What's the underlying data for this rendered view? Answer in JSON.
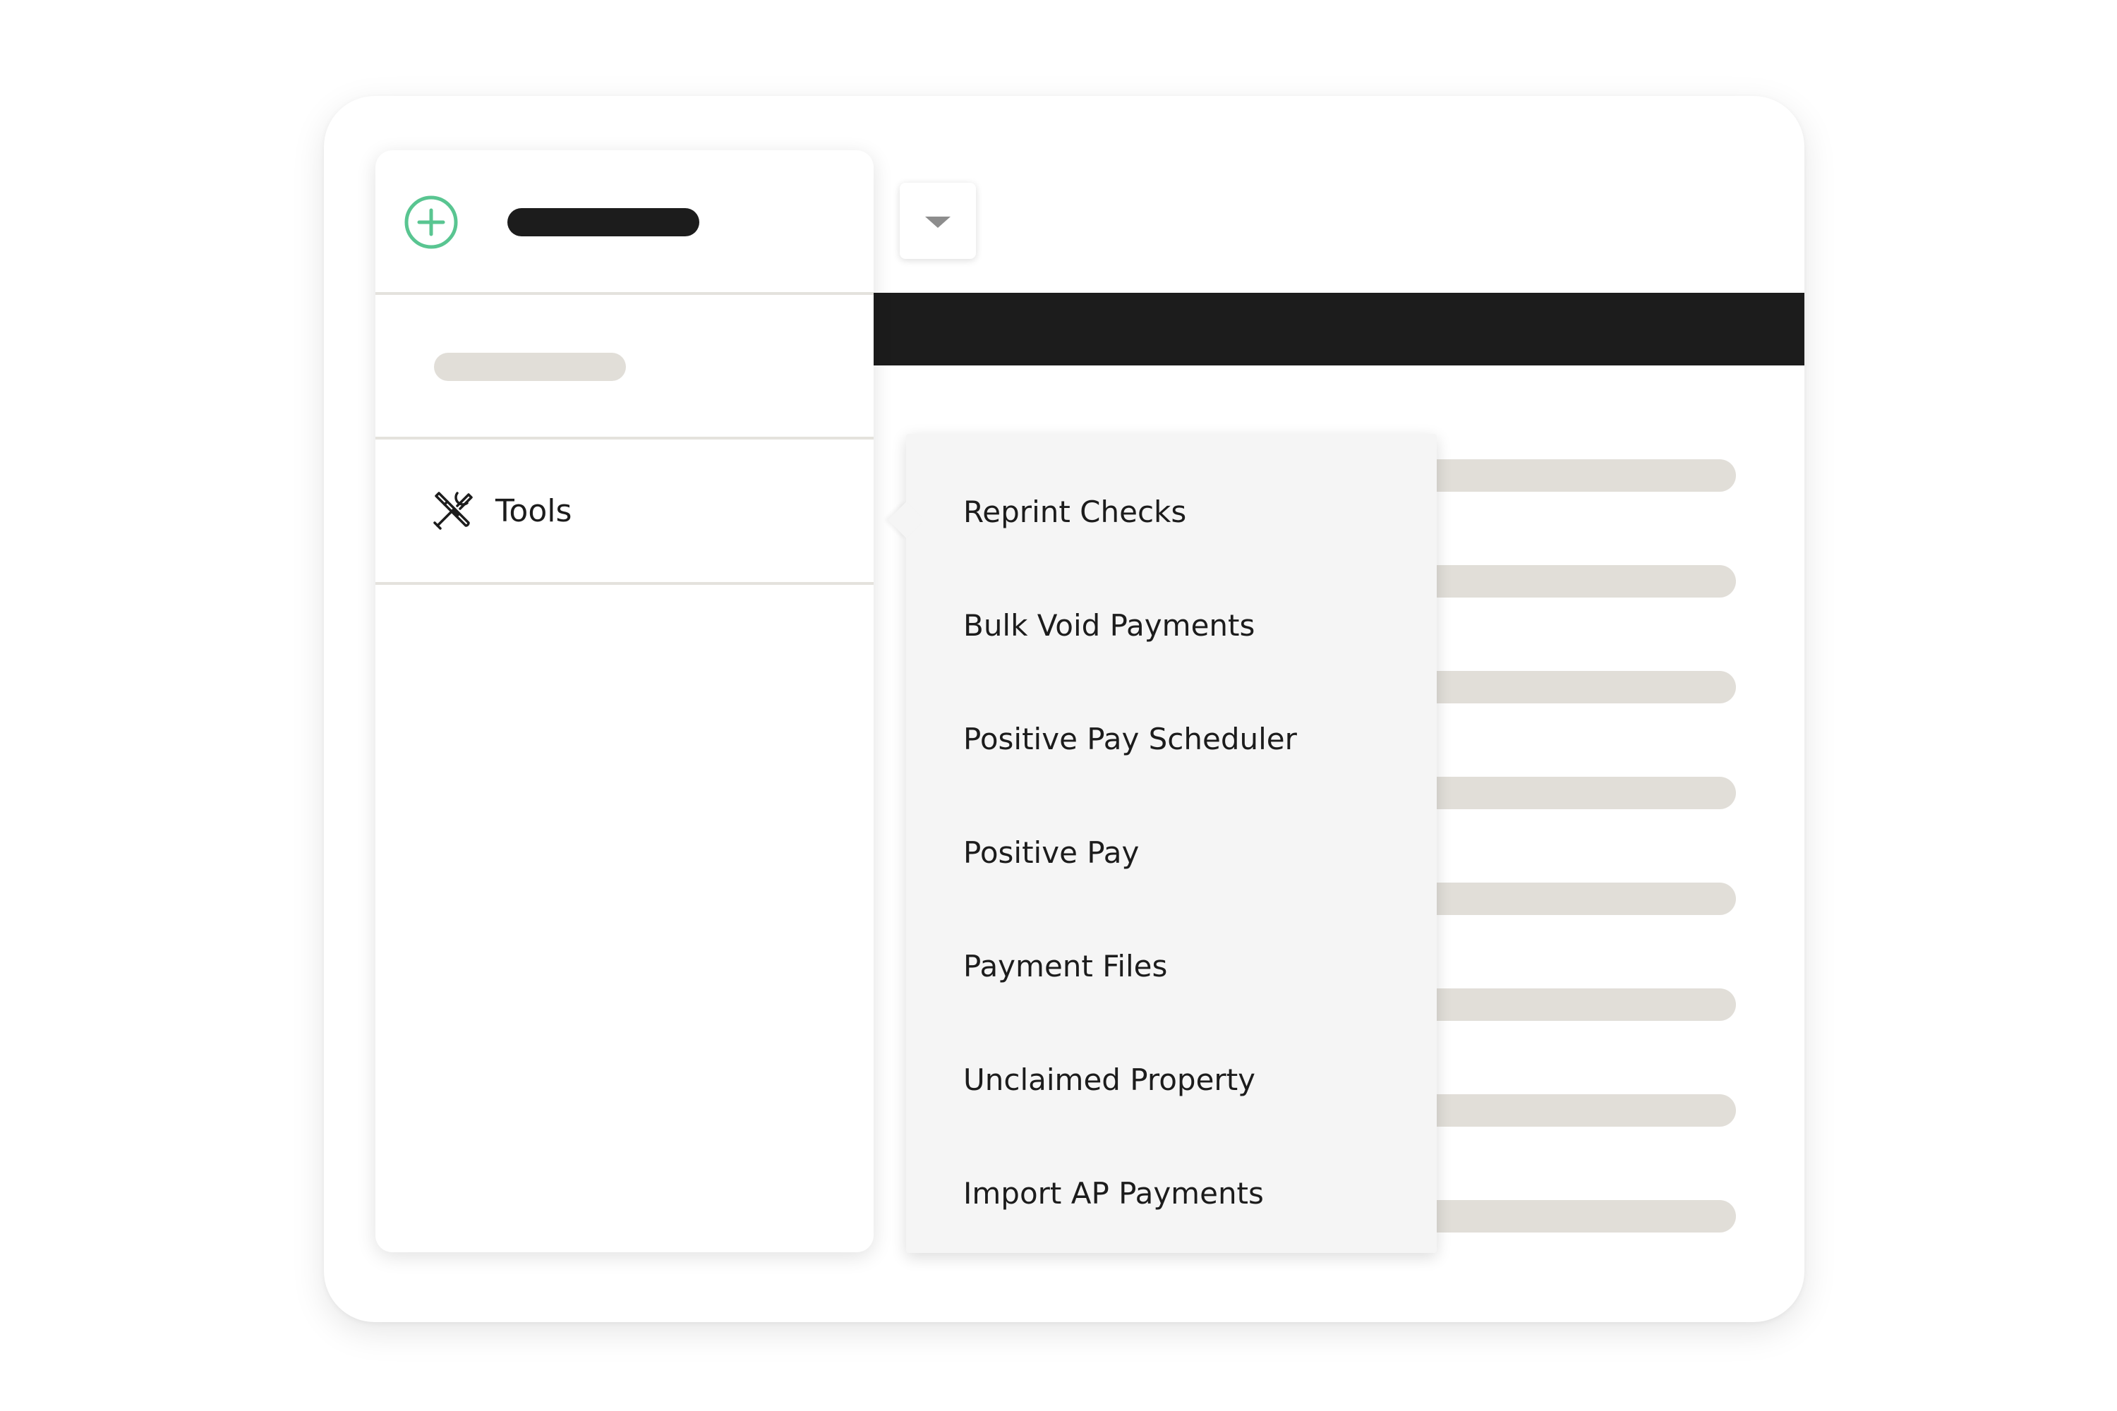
{
  "sidebar": {
    "tools_label": "Tools"
  },
  "flyout_menu": {
    "items": [
      "Reprint Checks",
      "Bulk Void Payments",
      "Positive Pay Scheduler",
      "Positive Pay",
      "Payment Files",
      "Unclaimed Property",
      "Import AP Payments"
    ]
  },
  "icons": {
    "add": "plus-circle-icon",
    "tools": "tools-icon",
    "dropdown": "caret-down-icon"
  },
  "colors": {
    "accent": "#59c591",
    "dark_bar": "#1c1c1c",
    "placeholder": "#e1ded8",
    "menu_bg": "#f5f5f5"
  }
}
